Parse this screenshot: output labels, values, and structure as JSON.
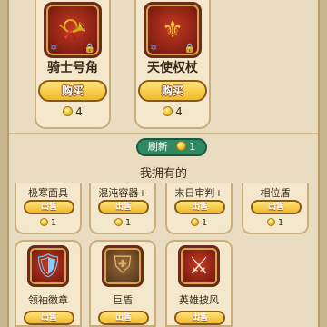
{
  "shop": {
    "items": [
      {
        "name": "骑士号角",
        "buy_label": "购买",
        "price": "4",
        "icon": "horn-icon"
      },
      {
        "name": "天使权杖",
        "buy_label": "购买",
        "price": "4",
        "icon": "angel-scepter-icon"
      }
    ]
  },
  "refresh": {
    "label": "刷新",
    "cost": "1"
  },
  "owned": {
    "title": "我拥有的",
    "row1": [
      {
        "name": "极寒面具",
        "sell_label": "出售",
        "price": "1"
      },
      {
        "name": "混沌容器+",
        "sell_label": "出售",
        "price": "1"
      },
      {
        "name": "末日审判+",
        "sell_label": "出售",
        "price": "1"
      },
      {
        "name": "相位盾",
        "sell_label": "出售",
        "price": "1"
      }
    ],
    "row2": [
      {
        "name": "领袖徽章",
        "sell_label": "出售",
        "icon": "leader-badge-icon"
      },
      {
        "name": "巨盾",
        "sell_label": "出售",
        "icon": "giant-shield-icon"
      },
      {
        "name": "英雄披风",
        "sell_label": "出售",
        "icon": "hero-cloak-icon"
      }
    ]
  },
  "colors": {
    "panel": "#e9dcc0",
    "button": "#f0b92a",
    "refresh": "#2f8a63"
  }
}
